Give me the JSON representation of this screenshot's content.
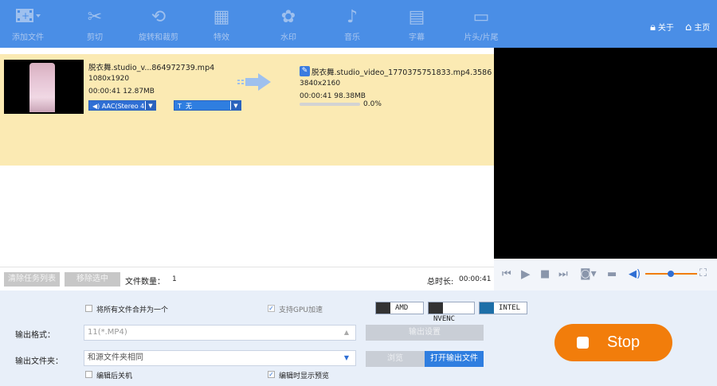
{
  "toolbar": {
    "items": [
      {
        "label": "添加文件",
        "icon": "film-add-icon"
      },
      {
        "label": "剪切",
        "icon": "scissors-icon"
      },
      {
        "label": "旋转和裁剪",
        "icon": "rotate-crop-icon"
      },
      {
        "label": "特效",
        "icon": "effects-icon"
      },
      {
        "label": "水印",
        "icon": "watermark-icon"
      },
      {
        "label": "音乐",
        "icon": "music-icon"
      },
      {
        "label": "字幕",
        "icon": "subtitle-icon"
      },
      {
        "label": "片头/片尾",
        "icon": "intro-outro-icon"
      }
    ],
    "about": "关于",
    "home": "主页"
  },
  "task": {
    "source_name": "脱衣舞.studio_v...864972739.mp4",
    "source_resolution": "1080x1920",
    "source_duration_size": "00:00:41  12.87MB",
    "audio_track": "AAC(Stereo 4",
    "subtitle_track": "无",
    "subtitle_prefix": "T",
    "output_name": "脱衣舞.studio_video_1770375751833.mp4.3586",
    "output_resolution": "3840x2160",
    "output_duration_size": "00:00:41  98.38MB",
    "progress_text": "0.0%",
    "progress_value": 0.0
  },
  "status": {
    "clear_list": "清除任务列表",
    "remove_selected": "移除选中",
    "file_count_label": "文件数量：",
    "file_count": "1",
    "total_duration_label": "总时长:",
    "total_duration": "00:00:41"
  },
  "settings": {
    "merge_label": "将所有文件合并为一个",
    "merge_checked": false,
    "gpu_label": "支持GPU加速",
    "gpu_checked": true,
    "gpu_options": [
      "AMD",
      "NVENC",
      "INTEL"
    ],
    "output_format_label": "输出格式：",
    "output_format_value": "11(*.MP4)",
    "output_settings": "输出设置",
    "output_folder_label": "输出文件夹：",
    "output_folder_value": "和源文件夹相同",
    "browse": "浏览",
    "open_output": "打开输出文件",
    "shutdown_label": "编辑后关机",
    "shutdown_checked": false,
    "preview_label": "编辑时显示预览",
    "preview_checked": true,
    "stop_label": "Stop"
  },
  "colors": {
    "toolbar_bg": "#4a8ee6",
    "row_highlight": "#fbeab3",
    "stop_button": "#f27d0b",
    "accent_blue": "#2f7ee0"
  }
}
